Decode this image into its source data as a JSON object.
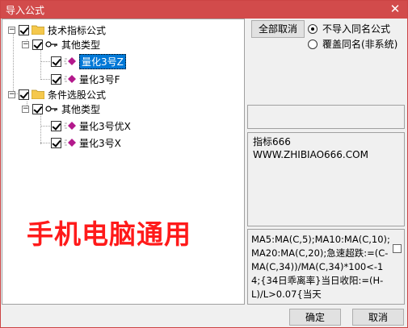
{
  "window": {
    "title": "导入公式",
    "close_label": "✕"
  },
  "tree": {
    "group1": {
      "label": "技术指标公式",
      "subgroup": "其他类型",
      "items": [
        "量化3号Z",
        "量化3号F"
      ]
    },
    "group2": {
      "label": "条件选股公式",
      "subgroup": "其他类型",
      "items": [
        "量化3号优X",
        "量化3号X"
      ]
    },
    "expander_symbol": "−"
  },
  "overlay": {
    "text": "手机电脑通用"
  },
  "options": {
    "deselect_all": "全部取消",
    "radio1": "不导入同名公式",
    "radio2": "覆盖同名(非系统)"
  },
  "info": {
    "line1": "指标666",
    "line2": "WWW.ZHIBIAO666.COM"
  },
  "code": {
    "text": "MA5:MA(C,5);MA10:MA(C,10);MA20:MA(C,20);急速超跌:=(C-MA(C,34))/MA(C,34)*100<-14;{34日乖离率}当日收阳:=(H-L)/L>0.07{当天"
  },
  "footer": {
    "ok": "确定",
    "cancel": "取消"
  },
  "colors": {
    "titlebar": "#d24b4b",
    "selection": "#0078d7",
    "overlay": "#ff1a1a",
    "folder": "#f5c84c",
    "formula": "#b3198c"
  }
}
